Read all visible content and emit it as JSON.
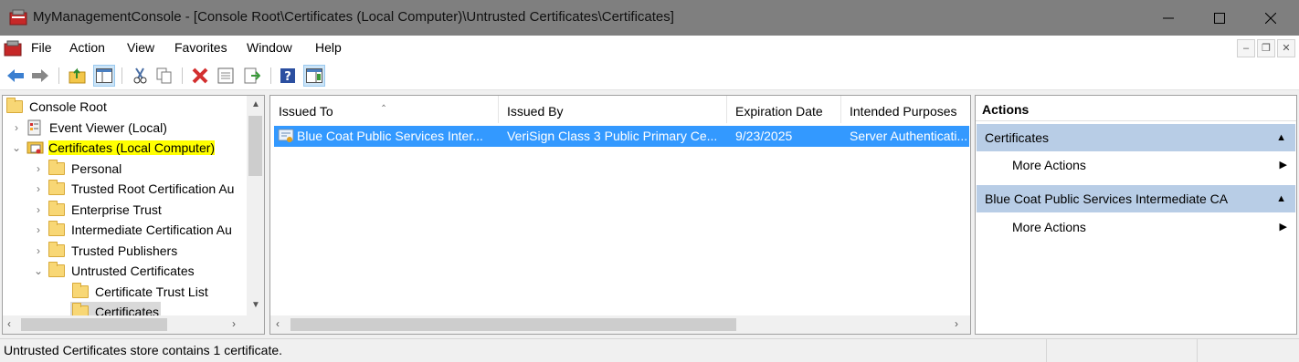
{
  "window": {
    "title": "MyManagementConsole - [Console Root\\Certificates (Local Computer)\\Untrusted Certificates\\Certificates]"
  },
  "menu": [
    "File",
    "Action",
    "View",
    "Favorites",
    "Window",
    "Help"
  ],
  "toolbar": {
    "icons": [
      "back-arrow-icon",
      "forward-arrow-icon",
      "up-folder-icon",
      "show-hide-tree-icon",
      "cut-icon",
      "copy-icon",
      "delete-icon",
      "properties-icon",
      "export-list-icon",
      "help-icon",
      "show-action-pane-icon"
    ]
  },
  "tree": {
    "items": [
      {
        "label": "Console Root",
        "level": 0,
        "expander": "",
        "icon": "folder"
      },
      {
        "label": "Event Viewer (Local)",
        "level": 1,
        "expander": ">",
        "icon": "event-viewer"
      },
      {
        "label": "Certificates (Local Computer)",
        "level": 1,
        "expander": "v",
        "icon": "certificates",
        "highlight": true
      },
      {
        "label": "Personal",
        "level": 2,
        "expander": ">",
        "icon": "folder"
      },
      {
        "label": "Trusted Root Certification Au",
        "level": 2,
        "expander": ">",
        "icon": "folder"
      },
      {
        "label": "Enterprise Trust",
        "level": 2,
        "expander": ">",
        "icon": "folder"
      },
      {
        "label": "Intermediate Certification Au",
        "level": 2,
        "expander": ">",
        "icon": "folder"
      },
      {
        "label": "Trusted Publishers",
        "level": 2,
        "expander": ">",
        "icon": "folder"
      },
      {
        "label": "Untrusted Certificates",
        "level": 2,
        "expander": "v",
        "icon": "folder"
      },
      {
        "label": "Certificate Trust List",
        "level": 3,
        "expander": "",
        "icon": "folder"
      },
      {
        "label": "Certificates",
        "level": 3,
        "expander": "",
        "icon": "folder",
        "selected": true
      }
    ]
  },
  "list": {
    "columns": [
      "Issued To",
      "Issued By",
      "Expiration Date",
      "Intended Purposes"
    ],
    "rows": [
      {
        "issued_to": "Blue Coat Public Services Inter...",
        "issued_by": "VeriSign Class 3 Public Primary Ce...",
        "expiration": "9/23/2025",
        "purposes": "Server Authenticati..."
      }
    ]
  },
  "actions": {
    "header": "Actions",
    "sections": [
      {
        "title": "Certificates",
        "items": [
          "More Actions"
        ]
      },
      {
        "title": "Blue Coat Public Services Intermediate CA",
        "items": [
          "More Actions"
        ]
      }
    ]
  },
  "status": {
    "text": "Untrusted Certificates store contains 1 certificate."
  },
  "colors": {
    "selection": "#3399ff",
    "highlight": "#ffff00",
    "action_section": "#b8cde6",
    "titlebar": "#7f7f7f"
  }
}
